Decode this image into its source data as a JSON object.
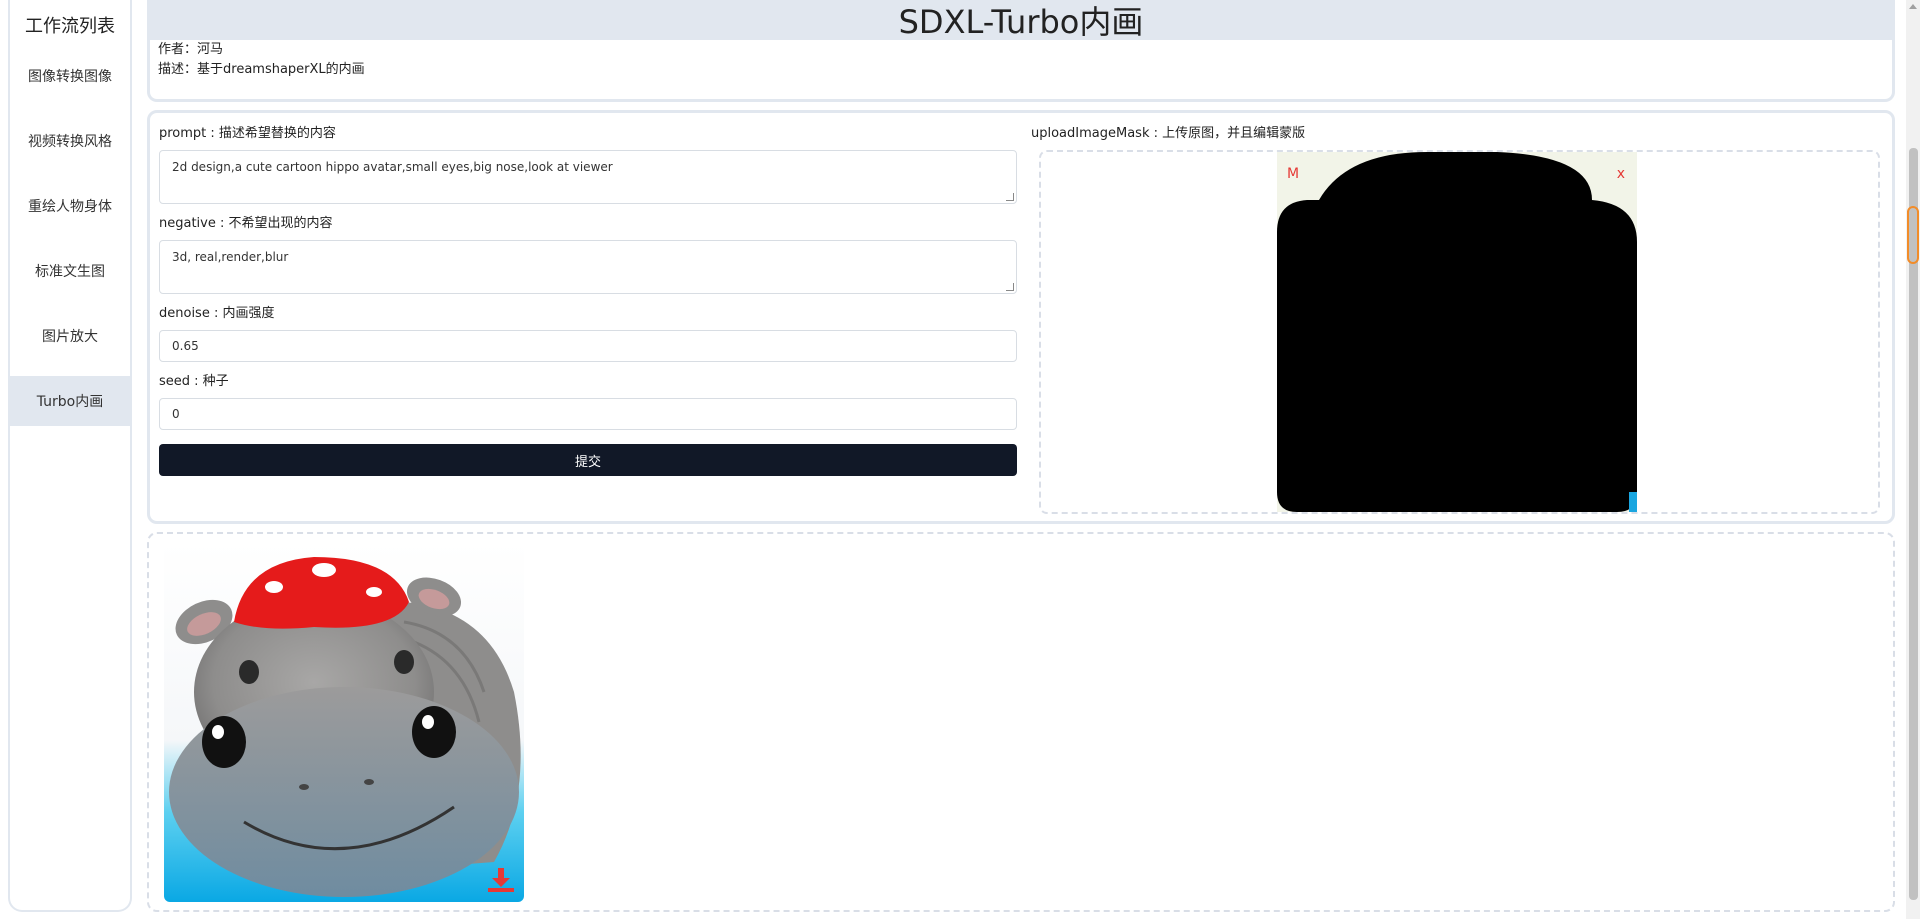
{
  "sidebar": {
    "title": "工作流列表",
    "items": [
      {
        "label": "图像转换图像"
      },
      {
        "label": "视频转换风格"
      },
      {
        "label": "重绘人物身体"
      },
      {
        "label": "标准文生图"
      },
      {
        "label": "图片放大"
      },
      {
        "label": "Turbo内画"
      }
    ],
    "active_index": 5
  },
  "header": {
    "title": "SDXL-Turbo内画",
    "author_label": "作者：",
    "author": "河马",
    "desc_label": "描述：",
    "desc": "基于dreamshaperXL的内画"
  },
  "form": {
    "prompt": {
      "label": "prompt : 描述希望替换的内容",
      "value": "2d design,a cute cartoon hippo avatar,small eyes,big nose,look at viewer"
    },
    "negative": {
      "label": "negative : 不希望出现的内容",
      "value": "3d, real,render,blur"
    },
    "denoise": {
      "label": "denoise : 内画强度",
      "value": "0.65"
    },
    "seed": {
      "label": "seed : 种子",
      "value": "0"
    },
    "submit_label": "提交",
    "upload": {
      "label": "uploadImageMask : 上传原图，并且编辑蒙版",
      "mask_marker": "M",
      "remove_marker": "x"
    }
  },
  "colors": {
    "accent_dark": "#111827",
    "panel_border": "#e1e7ef",
    "marker_red": "#e53935"
  }
}
